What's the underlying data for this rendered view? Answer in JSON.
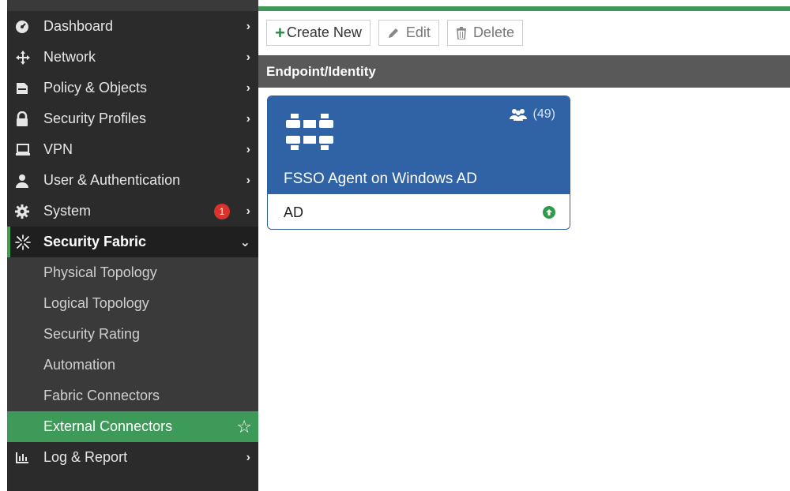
{
  "sidebar": {
    "items": [
      {
        "label": "Dashboard",
        "icon": "dashboard-icon"
      },
      {
        "label": "Network",
        "icon": "move-arrows-icon"
      },
      {
        "label": "Policy & Objects",
        "icon": "policy-icon"
      },
      {
        "label": "Security Profiles",
        "icon": "lock-icon"
      },
      {
        "label": "VPN",
        "icon": "laptop-icon"
      },
      {
        "label": "User & Authentication",
        "icon": "user-icon"
      },
      {
        "label": "System",
        "icon": "gear-icon",
        "badge": "1"
      },
      {
        "label": "Security Fabric",
        "icon": "security-fabric-icon"
      }
    ],
    "sub_items": [
      {
        "label": "Physical Topology"
      },
      {
        "label": "Logical Topology"
      },
      {
        "label": "Security Rating"
      },
      {
        "label": "Automation"
      },
      {
        "label": "Fabric Connectors"
      },
      {
        "label": "External Connectors"
      }
    ],
    "bottom_item": {
      "label": "Log & Report",
      "icon": "bar-chart-icon"
    }
  },
  "toolbar": {
    "create_label": "Create New",
    "edit_label": "Edit",
    "delete_label": "Delete"
  },
  "section": {
    "title": "Endpoint/Identity"
  },
  "card": {
    "count": "(49)",
    "name": "FSSO Agent on Windows AD",
    "footer": "AD"
  },
  "colors": {
    "accent_green": "#3d9a58",
    "card_blue": "#2f63a5",
    "sidebar_bg": "#2b2b2b",
    "badge_red": "#d9342b"
  }
}
